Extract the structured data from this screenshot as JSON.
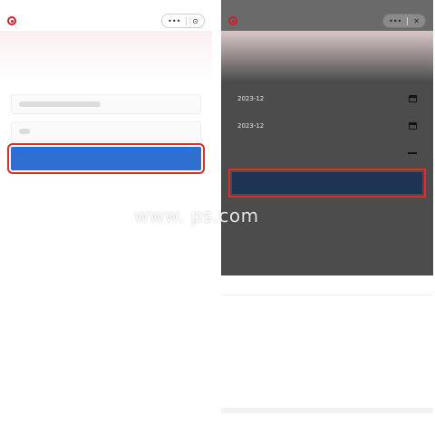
{
  "left": {
    "status": {
      "left": "",
      "right": ""
    },
    "brand": "",
    "capsule": {
      "more": "•••",
      "close": "⊙"
    },
    "title": "",
    "subtitle": "",
    "subtitle_link": "",
    "fields": [
      {
        "label": "",
        "value": ""
      },
      {
        "label": "",
        "value": ""
      }
    ],
    "query_button": "",
    "note_link": "",
    "footer": ""
  },
  "right": {
    "status": {
      "left": "",
      "right": ""
    },
    "brand": "",
    "capsule": {
      "more": "•••",
      "close": "✕"
    },
    "title": "",
    "subtitle": "",
    "subtitle_link": "",
    "fields": [
      {
        "label": "",
        "value": "2023-12"
      },
      {
        "label": "",
        "value": "2023-12"
      },
      {
        "label": "",
        "value": ""
      }
    ],
    "query_button": "",
    "sheet": {
      "title": "",
      "options": [
        "",
        "",
        "",
        ""
      ],
      "cancel": ""
    }
  },
  "watermark": "www.     ps.com",
  "colors": {
    "brand_red": "#c8232c",
    "button_blue": "#2f6fd0",
    "highlight_red": "#e02b2b",
    "dark_button": "#1d3454",
    "link_blue": "#2b67c8"
  },
  "icons": [
    "logo-icon",
    "more-icon",
    "close-icon",
    "calendar-icon",
    "dropdown-icon"
  ]
}
